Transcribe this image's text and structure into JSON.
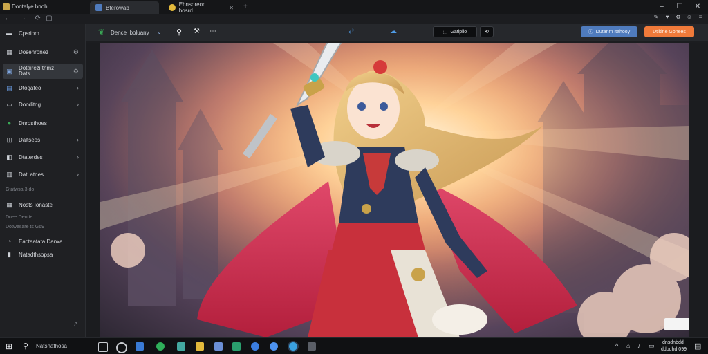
{
  "browser": {
    "window_label": "Dontelye bnoh",
    "tabs": [
      {
        "label": "Bterowab",
        "active": true
      },
      {
        "label": "Ehnsoreon bosrd",
        "active": false
      }
    ]
  },
  "header": {
    "title": "Dence Iboluany",
    "share_label": "Gatipilo",
    "outline_button_label": "Dutanm Itahooy",
    "primary_button_label": "Dtlitine Gonees"
  },
  "sidebar": {
    "items": [
      {
        "label": "Cpsriom",
        "icon": "folder-icon",
        "chevron": ""
      },
      {
        "label": "Dosehronez",
        "icon": "grid-icon",
        "chevron": "gear"
      },
      {
        "label": "Dotairezi tnmz\nDats",
        "icon": "image-icon",
        "chevron": "gear",
        "selected": true
      },
      {
        "label": "Dtogateo",
        "icon": "picture-icon",
        "chevron": ">"
      },
      {
        "label": "Dooditng",
        "icon": "tray-icon",
        "chevron": ">"
      },
      {
        "label": "Dnrosthoes",
        "icon": "circle-icon",
        "chevron": ""
      },
      {
        "label": "Daltseos",
        "icon": "box-icon",
        "chevron": ">"
      },
      {
        "label": "Dtaterdes",
        "icon": "stack-icon",
        "chevron": ">"
      },
      {
        "label": "Datl atnes",
        "icon": "layers-icon",
        "chevron": ">"
      }
    ],
    "section_1": "Gtatwsa 3 do",
    "item_after_section_1": "Nosts Ionaste",
    "section_2a": "Doee Deotte",
    "section_2b": "Dotwesare ts G69",
    "bottom_items": [
      "Eactaatata Danxa",
      "Natadthsopsa"
    ]
  },
  "taskbar": {
    "search_label": "Natsnathosa",
    "clock_time": "dnsdnbdd",
    "clock_date": "ddodhd 099"
  },
  "colors": {
    "accent_blue": "#4f7bbd",
    "primary_orange": "#f07a3a",
    "tab_yellow": "#e2b93b"
  }
}
